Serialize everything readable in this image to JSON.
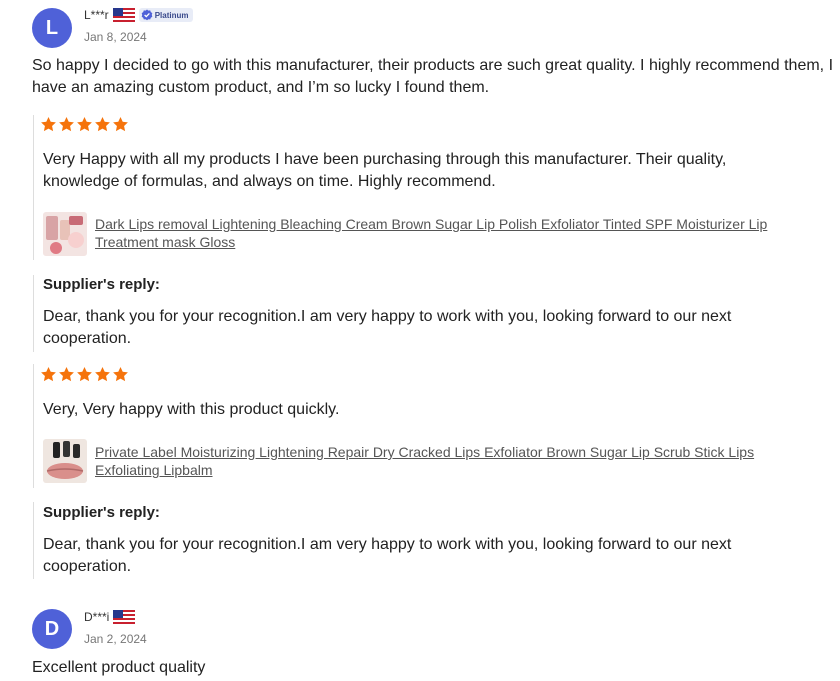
{
  "reviews": [
    {
      "avatar_letter": "L",
      "username": "L***r",
      "badge": "Platinum",
      "date": "Jan 8, 2024",
      "comment": "So happy I decided to go with this manufacturer, their products are such great quality. I highly recommend them, I have an amazing custom product, and I’m so lucky I found them.",
      "items": [
        {
          "rating": 5,
          "text": "Very Happy with all my products I have been purchasing through this manufacturer. Their quality, knowledge of formulas, and always on time. Highly recommend.",
          "product": "Dark Lips removal Lightening Bleaching Cream Brown Sugar Lip Polish Exfoliator Tinted SPF Moisturizer Lip Treatment mask Gloss",
          "reply_title": "Supplier's reply:",
          "reply": "Dear, thank you for your recognition.I am very happy to work with you, looking forward to our next cooperation."
        },
        {
          "rating": 5,
          "text": "Very, Very happy with this product quickly.",
          "product": "Private Label Moisturizing Lightening Repair Dry Cracked Lips Exfoliator Brown Sugar Lip Scrub Stick Lips Exfoliating Lipbalm",
          "reply_title": "Supplier's reply:",
          "reply": "Dear, thank you for your recognition.I am very happy to work with you, looking forward to our next cooperation."
        }
      ]
    },
    {
      "avatar_letter": "D",
      "username": "D***i",
      "date": "Jan 2, 2024",
      "comment": "Excellent product quality"
    }
  ],
  "colors": {
    "avatar": "#4f61d8",
    "star": "#f5730b",
    "divider": "#dddddd"
  },
  "icons": {
    "star": "star-icon",
    "flag": "us-flag-icon",
    "verified": "verified-badge-icon"
  }
}
